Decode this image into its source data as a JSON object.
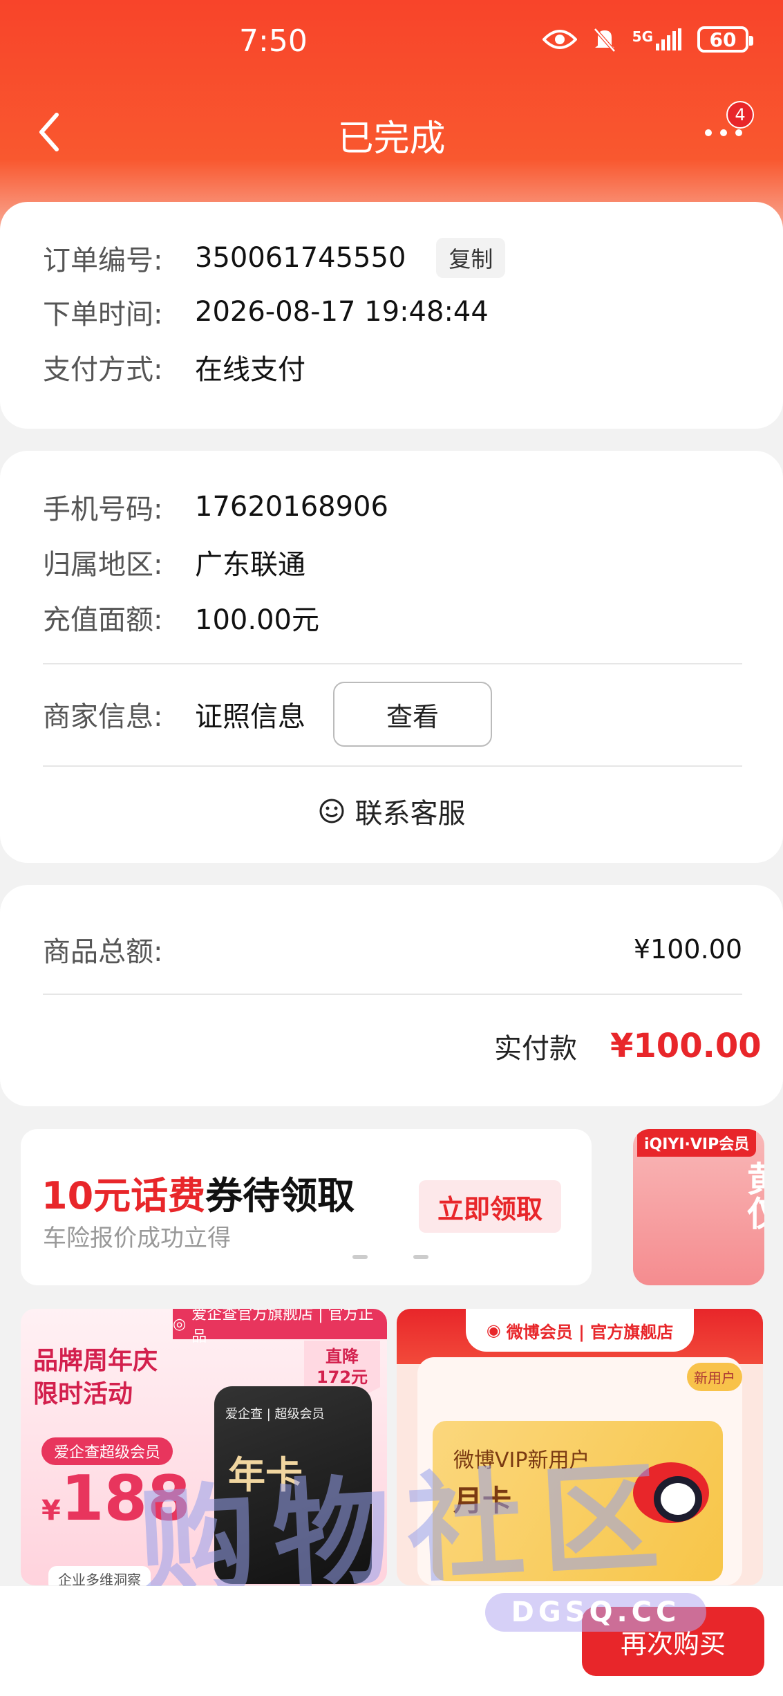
{
  "status_bar": {
    "time": "7:50",
    "network": "5G",
    "battery": "60"
  },
  "nav": {
    "title": "已完成",
    "badge_count": "4"
  },
  "order": {
    "number_label": "订单编号:",
    "number_value": "350061745550",
    "copy_label": "复制",
    "time_label": "下单时间:",
    "time_value": "2026-08-17 19:48:44",
    "pay_label": "支付方式:",
    "pay_value": "在线支付"
  },
  "recharge": {
    "phone_label": "手机号码:",
    "phone_value": "17620168906",
    "region_label": "归属地区:",
    "region_value": "广东联通",
    "amount_label": "充值面额:",
    "amount_value": "100.00元",
    "merchant_label": "商家信息:",
    "merchant_value": "证照信息",
    "view_label": "查看",
    "service_label": "联系客服"
  },
  "totals": {
    "goods_label": "商品总额:",
    "goods_value": "¥100.00",
    "paid_label": "实付款",
    "paid_value": "¥100.00"
  },
  "promo": {
    "title_highlight": "10元话费",
    "title_rest": "券待领取",
    "subtitle": "车险报价成功立得",
    "button": "立即领取",
    "side_tag": "iQIYI·VIP会员",
    "side_chars": "黄仅"
  },
  "products": [
    {
      "store": "爱企查官方旗舰店 | 官方正品",
      "headline_1": "品牌周年庆",
      "headline_2": "限时活动",
      "chip": "爱企查超级会员",
      "price_symbol": "¥",
      "price": "188",
      "drop_1": "直降",
      "drop_2": "172元",
      "card_title": "爱企查 | 超级会员",
      "card_type": "年卡",
      "footer": "企业多维洞察"
    },
    {
      "store": "微博会员 | 官方旗舰店",
      "new_tag": "新用户",
      "card_title": "微博VIP新用户",
      "card_type": "月卡"
    }
  ],
  "watermark": {
    "text": "购物社区",
    "url": "DGSQ.CC"
  },
  "bottom": {
    "rebuy": "再次购买"
  },
  "colors": {
    "brand_red": "#e8262a",
    "header_orange": "#f8442a"
  }
}
